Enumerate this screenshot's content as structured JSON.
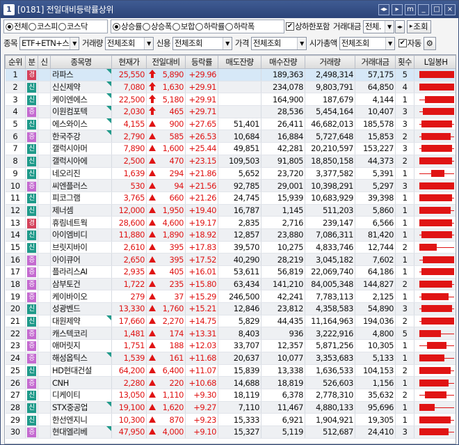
{
  "window": {
    "badge": "1",
    "title": "[0181] 전일대비등락률상위",
    "buttons": [
      "◂▸",
      "▸",
      "m",
      "_",
      "□",
      "×"
    ]
  },
  "filters1": {
    "market": [
      "전체",
      "코스피",
      "코스닥"
    ],
    "market_selected": 0,
    "sort": [
      "상승률",
      "상승폭",
      "보합",
      "하락률",
      "하락폭"
    ],
    "sort_selected": 0,
    "limit_include_label": "상하한포함",
    "limit_include_checked": true,
    "amount_label": "거래대금",
    "amount_value": "전체.",
    "query_label": "조회"
  },
  "filters2": {
    "item_label": "종목",
    "item_value": "ETF+ETN+스",
    "volume_label": "거래량",
    "volume_value": "전체조회",
    "credit_label": "신용",
    "credit_value": "전체조회",
    "price_label": "가격",
    "price_value": "전체조회",
    "mktcap_label": "시가총액",
    "mktcap_value": "전체조회",
    "auto_label": "자동",
    "auto_checked": true
  },
  "columns": [
    "순위",
    "분",
    "신",
    "종목명",
    "현재가",
    "전일대비",
    "등락률",
    "매도잔량",
    "매수잔량",
    "거래량",
    "거래대금",
    "횟수",
    "L일봉H"
  ],
  "rows": [
    {
      "rank": "1",
      "div": "경",
      "credit": "",
      "name": "라파스",
      "price": "25,550",
      "arrow": "big",
      "diff": "5,890",
      "rate": "+29.96",
      "sell": "",
      "buy": "189,363",
      "vol": "2,498,314",
      "amt": "57,175",
      "cnt": "5",
      "candle": [
        0.05,
        0.95,
        0.05,
        0.95
      ]
    },
    {
      "rank": "2",
      "div": "신",
      "credit": "",
      "name": "신신제약",
      "price": "7,080",
      "arrow": "big",
      "diff": "1,630",
      "rate": "+29.91",
      "sell": "",
      "buy": "234,078",
      "vol": "9,803,791",
      "amt": "64,850",
      "cnt": "4",
      "candle": [
        0.05,
        0.95,
        0.05,
        0.95
      ]
    },
    {
      "rank": "3",
      "div": "신",
      "credit": "",
      "name": "케이엔에스",
      "price": "22,500",
      "arrow": "big",
      "diff": "5,180",
      "rate": "+29.91",
      "sell": "",
      "buy": "164,900",
      "vol": "187,679",
      "amt": "4,144",
      "cnt": "1",
      "candle": [
        0.05,
        0.95,
        0.2,
        0.95
      ]
    },
    {
      "rank": "4",
      "div": "증",
      "credit": "",
      "name": "이원컴포텍",
      "price": "2,030",
      "arrow": "big",
      "diff": "465",
      "rate": "+29.71",
      "sell": "",
      "buy": "28,536",
      "vol": "5,454,164",
      "amt": "10,407",
      "cnt": "3",
      "candle": [
        0.05,
        0.95,
        0.15,
        0.95
      ]
    },
    {
      "rank": "5",
      "div": "신",
      "credit": "",
      "name": "에스와이스",
      "price": "4,155",
      "arrow": "small",
      "diff": "900",
      "rate": "+27.65",
      "sell": "51,401",
      "buy": "26,411",
      "vol": "46,682,013",
      "amt": "185,578",
      "cnt": "3",
      "candle": [
        0.05,
        0.95,
        0.1,
        0.9
      ]
    },
    {
      "rank": "6",
      "div": "증",
      "credit": "",
      "name": "한국주강",
      "price": "2,790",
      "arrow": "small",
      "diff": "585",
      "rate": "+26.53",
      "sell": "10,684",
      "buy": "16,884",
      "vol": "5,727,648",
      "amt": "15,853",
      "cnt": "2",
      "candle": [
        0.05,
        0.95,
        0.1,
        0.85
      ]
    },
    {
      "rank": "7",
      "div": "신",
      "credit": "",
      "name": "갤럭시아머",
      "price": "7,890",
      "arrow": "small",
      "diff": "1,600",
      "rate": "+25.44",
      "sell": "49,851",
      "buy": "42,281",
      "vol": "20,210,597",
      "amt": "153,227",
      "cnt": "3",
      "candle": [
        0.05,
        0.95,
        0.1,
        0.9
      ]
    },
    {
      "rank": "8",
      "div": "신",
      "credit": "",
      "name": "갤럭시아에",
      "price": "2,500",
      "arrow": "small",
      "diff": "470",
      "rate": "+23.15",
      "sell": "109,503",
      "buy": "91,805",
      "vol": "18,850,158",
      "amt": "44,373",
      "cnt": "2",
      "candle": [
        0.05,
        0.95,
        0.05,
        0.9
      ]
    },
    {
      "rank": "9",
      "div": "신",
      "credit": "",
      "name": "네오리진",
      "price": "1,639",
      "arrow": "small",
      "diff": "294",
      "rate": "+21.86",
      "sell": "5,652",
      "buy": "23,720",
      "vol": "3,377,582",
      "amt": "5,391",
      "cnt": "1",
      "candle": [
        0.05,
        0.95,
        0.35,
        0.7
      ]
    },
    {
      "rank": "10",
      "div": "증",
      "credit": "",
      "name": "씨엔플러스",
      "price": "530",
      "arrow": "small",
      "diff": "94",
      "rate": "+21.56",
      "sell": "92,785",
      "buy": "29,001",
      "vol": "10,398,291",
      "amt": "5,297",
      "cnt": "3",
      "candle": [
        0.05,
        0.95,
        0.05,
        0.95
      ]
    },
    {
      "rank": "11",
      "div": "신",
      "credit": "",
      "name": "피코그램",
      "price": "3,765",
      "arrow": "small",
      "diff": "660",
      "rate": "+21.26",
      "sell": "24,745",
      "buy": "15,939",
      "vol": "10,683,929",
      "amt": "39,398",
      "cnt": "1",
      "candle": [
        0.05,
        0.95,
        0.05,
        0.9
      ]
    },
    {
      "rank": "12",
      "div": "신",
      "credit": "",
      "name": "제너셈",
      "price": "12,000",
      "arrow": "small",
      "diff": "1,950",
      "rate": "+19.40",
      "sell": "16,787",
      "buy": "1,145",
      "vol": "511,203",
      "amt": "5,860",
      "cnt": "1",
      "candle": [
        0.05,
        0.95,
        0.05,
        0.85
      ]
    },
    {
      "rank": "13",
      "div": "경",
      "credit": "",
      "name": "휴림네트웍",
      "price": "28,600",
      "arrow": "small",
      "diff": "4,600",
      "rate": "+19.17",
      "sell": "2,835",
      "buy": "2,716",
      "vol": "239,147",
      "amt": "6,566",
      "cnt": "1",
      "candle": [
        0.05,
        0.95,
        0.05,
        0.9
      ]
    },
    {
      "rank": "14",
      "div": "신",
      "credit": "",
      "name": "아이엠비디",
      "price": "11,880",
      "arrow": "small",
      "diff": "1,890",
      "rate": "+18.92",
      "sell": "12,857",
      "buy": "23,880",
      "vol": "7,086,311",
      "amt": "81,420",
      "cnt": "1",
      "candle": [
        0.05,
        0.95,
        0.1,
        0.9
      ]
    },
    {
      "rank": "15",
      "div": "신",
      "credit": "",
      "name": "브릿지바이",
      "price": "2,610",
      "arrow": "small",
      "diff": "395",
      "rate": "+17.83",
      "sell": "39,570",
      "buy": "10,275",
      "vol": "4,833,746",
      "amt": "12,744",
      "cnt": "2",
      "candle": [
        0.05,
        0.95,
        0.05,
        0.5
      ]
    },
    {
      "rank": "16",
      "div": "증",
      "credit": "",
      "name": "아이큐어",
      "price": "2,650",
      "arrow": "small",
      "diff": "395",
      "rate": "+17.52",
      "sell": "40,290",
      "buy": "28,219",
      "vol": "3,045,182",
      "amt": "7,602",
      "cnt": "1",
      "candle": [
        0.05,
        0.95,
        0.15,
        0.95
      ]
    },
    {
      "rank": "17",
      "div": "증",
      "credit": "",
      "name": "플라리스AI",
      "price": "2,935",
      "arrow": "small",
      "diff": "405",
      "rate": "+16.01",
      "sell": "53,611",
      "buy": "56,819",
      "vol": "22,069,740",
      "amt": "64,186",
      "cnt": "1",
      "candle": [
        0.05,
        0.95,
        0.1,
        0.95
      ]
    },
    {
      "rank": "18",
      "div": "증",
      "credit": "",
      "name": "삼부토건",
      "price": "1,722",
      "arrow": "small",
      "diff": "235",
      "rate": "+15.80",
      "sell": "63,434",
      "buy": "141,210",
      "vol": "84,005,348",
      "amt": "144,827",
      "cnt": "2",
      "candle": [
        0.05,
        0.95,
        0.05,
        0.9
      ]
    },
    {
      "rank": "19",
      "div": "증",
      "credit": "",
      "name": "케이바이오",
      "price": "279",
      "arrow": "small",
      "diff": "37",
      "rate": "+15.29",
      "sell": "246,500",
      "buy": "42,241",
      "vol": "7,783,113",
      "amt": "2,125",
      "cnt": "1",
      "candle": [
        0.05,
        0.95,
        0.1,
        0.8
      ]
    },
    {
      "rank": "20",
      "div": "신",
      "credit": "",
      "name": "성광벤드",
      "price": "13,330",
      "arrow": "small",
      "diff": "1,760",
      "rate": "+15.21",
      "sell": "12,846",
      "buy": "23,812",
      "vol": "4,358,583",
      "amt": "54,890",
      "cnt": "3",
      "candle": [
        0.05,
        0.95,
        0.1,
        0.9
      ]
    },
    {
      "rank": "21",
      "div": "신",
      "credit": "",
      "name": "대원제약",
      "price": "17,660",
      "arrow": "small",
      "diff": "2,270",
      "rate": "+14.75",
      "sell": "5,829",
      "buy": "44,435",
      "vol": "11,164,963",
      "amt": "194,036",
      "cnt": "2",
      "candle": [
        0.05,
        0.95,
        0.1,
        0.95
      ]
    },
    {
      "rank": "22",
      "div": "증",
      "credit": "",
      "name": "캐스텍코리",
      "price": "1,481",
      "arrow": "small",
      "diff": "174",
      "rate": "+13.31",
      "sell": "8,403",
      "buy": "936",
      "vol": "3,222,916",
      "amt": "4,800",
      "cnt": "5",
      "candle": [
        0.05,
        0.95,
        0.05,
        0.6
      ]
    },
    {
      "rank": "23",
      "div": "증",
      "credit": "",
      "name": "애머릿지",
      "price": "1,751",
      "arrow": "small",
      "diff": "188",
      "rate": "+12.03",
      "sell": "33,707",
      "buy": "12,357",
      "vol": "5,871,256",
      "amt": "10,305",
      "cnt": "1",
      "candle": [
        0.05,
        0.95,
        0.25,
        0.75
      ]
    },
    {
      "rank": "24",
      "div": "증",
      "credit": "",
      "name": "해성옵틱스",
      "price": "1,539",
      "arrow": "small",
      "diff": "161",
      "rate": "+11.68",
      "sell": "20,637",
      "buy": "10,077",
      "vol": "3,353,683",
      "amt": "5,133",
      "cnt": "1",
      "candle": [
        0.05,
        0.95,
        0.05,
        0.7
      ]
    },
    {
      "rank": "25",
      "div": "신",
      "credit": "",
      "name": "HD현대건설",
      "price": "64,200",
      "arrow": "small",
      "diff": "6,400",
      "rate": "+11.07",
      "sell": "15,839",
      "buy": "13,338",
      "vol": "1,636,533",
      "amt": "104,153",
      "cnt": "2",
      "candle": [
        0.05,
        0.95,
        0.05,
        0.85
      ]
    },
    {
      "rank": "26",
      "div": "증",
      "credit": "",
      "name": "CNH",
      "price": "2,280",
      "arrow": "small",
      "diff": "220",
      "rate": "+10.68",
      "sell": "14,688",
      "buy": "18,819",
      "vol": "526,603",
      "amt": "1,156",
      "cnt": "1",
      "candle": [
        0.05,
        0.95,
        0.05,
        0.8
      ]
    },
    {
      "rank": "27",
      "div": "신",
      "credit": "",
      "name": "디케이티",
      "price": "13,050",
      "arrow": "small",
      "diff": "1,110",
      "rate": "+9.30",
      "sell": "18,119",
      "buy": "6,378",
      "vol": "2,778,310",
      "amt": "35,632",
      "cnt": "2",
      "candle": [
        0.05,
        0.95,
        0.2,
        0.75
      ]
    },
    {
      "rank": "28",
      "div": "신",
      "credit": "",
      "name": "STX중공업",
      "price": "19,100",
      "arrow": "small",
      "diff": "1,620",
      "rate": "+9.27",
      "sell": "7,110",
      "buy": "11,467",
      "vol": "4,880,133",
      "amt": "95,696",
      "cnt": "1",
      "candle": [
        0.05,
        0.95,
        0.05,
        0.45
      ]
    },
    {
      "rank": "29",
      "div": "신",
      "credit": "",
      "name": "한선엔지니",
      "price": "10,300",
      "arrow": "small",
      "diff": "870",
      "rate": "+9.23",
      "sell": "15,333",
      "buy": "6,921",
      "vol": "1,904,921",
      "amt": "19,305",
      "cnt": "1",
      "candle": [
        0.05,
        0.95,
        0.05,
        0.85
      ]
    },
    {
      "rank": "30",
      "div": "증",
      "credit": "",
      "name": "현대엘리베",
      "price": "47,950",
      "arrow": "small",
      "diff": "4,000",
      "rate": "+9.10",
      "sell": "15,327",
      "buy": "5,119",
      "vol": "512,687",
      "amt": "24,410",
      "cnt": "3",
      "candle": [
        0.05,
        0.95,
        0.05,
        0.8
      ]
    }
  ],
  "colors": {
    "up": "#e01414",
    "title_bg": "#2c4478",
    "selected_row": "#d6e8f7",
    "alt_row": "#eef0f3"
  }
}
